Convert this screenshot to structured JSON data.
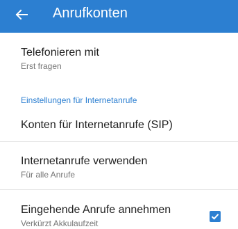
{
  "appbar": {
    "back_icon": "arrow-left-icon",
    "title": "Anrufkonten",
    "color": "#2c7fd1"
  },
  "preferences": [
    {
      "title": "Telefonieren mit",
      "summary": "Erst fragen"
    },
    {
      "category": "Einstellungen für Internetanrufe"
    },
    {
      "title": "Konten für Internetanrufe (SIP)"
    },
    {
      "title": "Internetanrufe verwenden",
      "summary": "Für alle Anrufe"
    },
    {
      "title": "Eingehende Anrufe annehmen",
      "summary": "Verkürzt Akkulaufzeit",
      "checked": true
    }
  ]
}
